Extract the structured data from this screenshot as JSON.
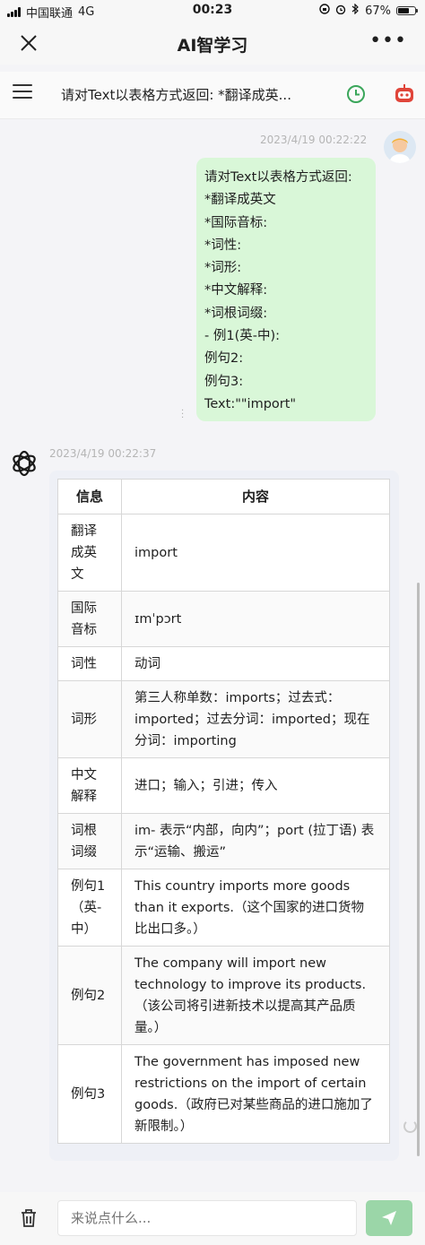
{
  "status_bar": {
    "carrier": "中国联通",
    "network": "4G",
    "time": "00:23",
    "battery": "67%",
    "battery_level": 0.67
  },
  "header": {
    "title": "AI智学习"
  },
  "chat_header": {
    "title": "请对Text以表格方式返回: *翻译成英..."
  },
  "user_message": {
    "timestamp": "2023/4/19 00:22:22",
    "lines": [
      "请对Text以表格方式返回:",
      "*翻译成英文",
      "*国际音标:",
      "*词性:",
      "*词形:",
      "*中文解释:",
      "*词根词缀:",
      "- 例1(英-中):",
      "例句2:",
      "例句3:",
      "Text:\"\"import\""
    ]
  },
  "ai_message": {
    "timestamp": "2023/4/19 00:22:37",
    "table": {
      "headers": [
        "信息",
        "内容"
      ],
      "rows": [
        {
          "k": "翻译成英文",
          "v": "import"
        },
        {
          "k": "国际音标",
          "v": "ɪmˈpɔrt"
        },
        {
          "k": "词性",
          "v": "动词"
        },
        {
          "k": "词形",
          "v": "第三人称单数：imports；过去式：imported；过去分词：imported；现在分词：importing"
        },
        {
          "k": "中文解释",
          "v": "进口；输入；引进；传入"
        },
        {
          "k": "词根词缀",
          "v": "im- 表示“内部，向内”；port (拉丁语) 表示“运输、搬运”"
        },
        {
          "k": "例句1（英-中）",
          "v": "This country imports more goods than it exports.（这个国家的进口货物比出口多。）"
        },
        {
          "k": "例句2",
          "v": "The company will import new technology to improve its products.（该公司将引进新技术以提高其产品质量。）"
        },
        {
          "k": "例句3",
          "v": "The government has imposed new restrictions on the import of certain goods.（政府已对某些商品的进口施加了新限制。）"
        }
      ]
    }
  },
  "composer": {
    "placeholder": "来说点什么..."
  },
  "colors": {
    "user_bubble": "#d9f7d8",
    "accent_green": "#9bd6a8",
    "bot_red": "#e0453a"
  }
}
